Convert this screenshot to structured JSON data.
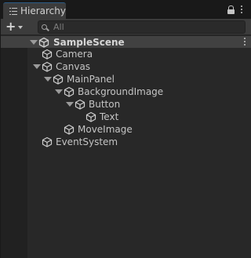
{
  "window": {
    "tab_title": "Hierarchy",
    "tab_icon": "list-icon",
    "lock_icon": "lock-icon",
    "menu_icon": "kebab-menu-icon"
  },
  "toolbar": {
    "create_label": "+",
    "create_caret_icon": "caret-down-icon",
    "search_placeholder": "All",
    "search_icon": "search-icon"
  },
  "tree": {
    "scene": {
      "label": "SampleScene",
      "icon": "unity-logo-icon",
      "expanded": true
    },
    "items": [
      {
        "label": "Camera",
        "depth": 0,
        "expandable": false,
        "icon": "gameobject-cube-icon"
      },
      {
        "label": "Canvas",
        "depth": 0,
        "expandable": true,
        "expanded": true,
        "icon": "gameobject-cube-icon"
      },
      {
        "label": "MainPanel",
        "depth": 1,
        "expandable": true,
        "expanded": true,
        "icon": "gameobject-cube-icon"
      },
      {
        "label": "BackgroundImage",
        "depth": 2,
        "expandable": true,
        "expanded": true,
        "icon": "gameobject-cube-icon"
      },
      {
        "label": "Button",
        "depth": 3,
        "expandable": true,
        "expanded": true,
        "icon": "gameobject-cube-icon"
      },
      {
        "label": "Text",
        "depth": 4,
        "expandable": false,
        "icon": "gameobject-cube-icon"
      },
      {
        "label": "MoveImage",
        "depth": 2,
        "expandable": false,
        "icon": "gameobject-cube-icon"
      },
      {
        "label": "EventSystem",
        "depth": 0,
        "expandable": false,
        "icon": "gameobject-cube-icon"
      }
    ]
  },
  "colors": {
    "background": "#282828",
    "tab_bar": "#191919",
    "toolbar": "#3c3c3c",
    "scene_row": "#414141",
    "text": "#c4c4c4",
    "tab_accent": "#2c5d87"
  }
}
